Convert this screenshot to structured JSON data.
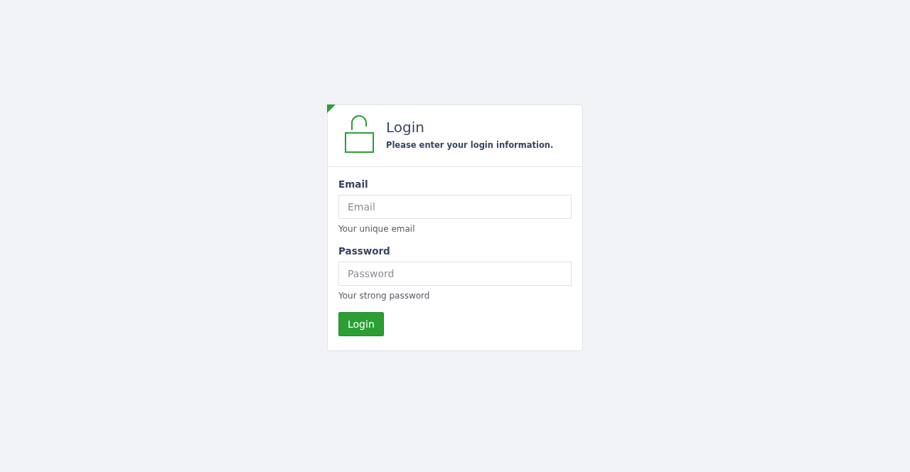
{
  "header": {
    "title": "Login",
    "subtitle": "Please enter your login information."
  },
  "fields": [
    {
      "label": "Email",
      "placeholder": "Email",
      "help": "Your unique email"
    },
    {
      "label": "Password",
      "placeholder": "Password",
      "help": "Your strong password"
    }
  ],
  "submit": "Login"
}
